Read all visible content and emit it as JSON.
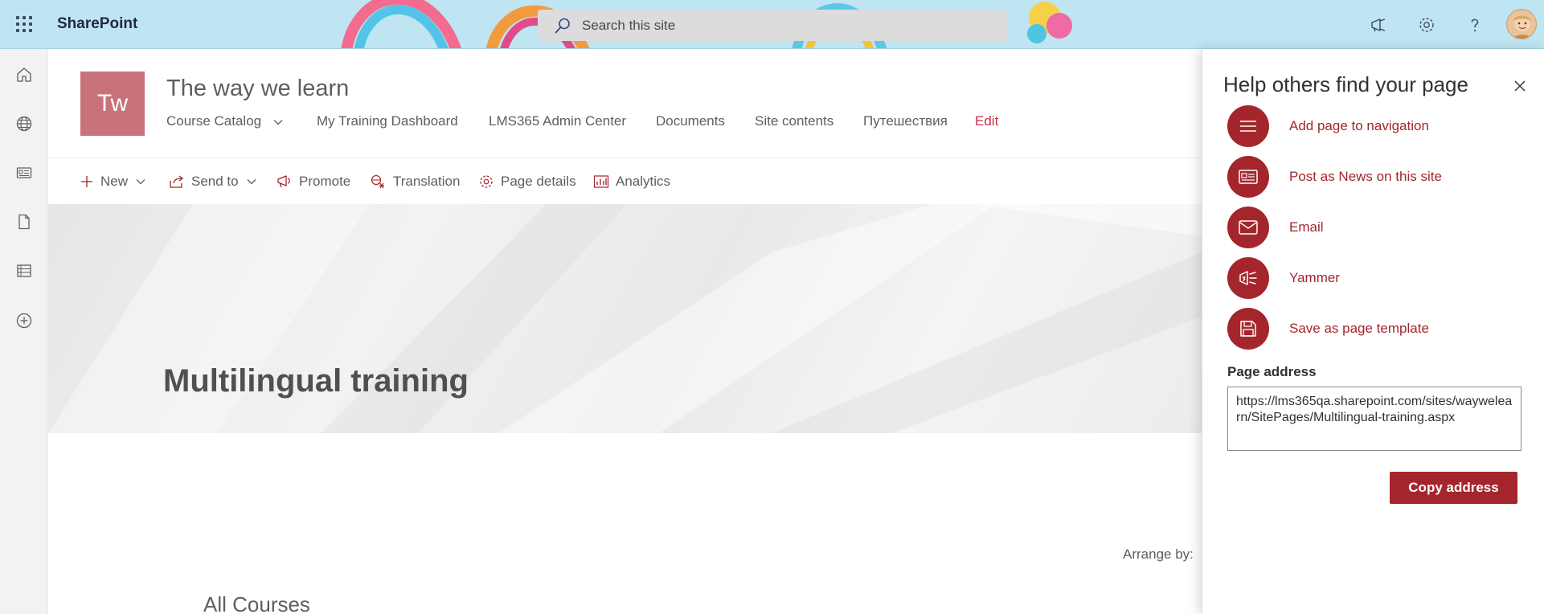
{
  "suitebar": {
    "brand": "SharePoint",
    "search_placeholder": "Search this site"
  },
  "site": {
    "logo_initials": "Tw",
    "title": "The way we learn",
    "nav": [
      {
        "label": "Course Catalog",
        "has_dropdown": true
      },
      {
        "label": "My Training Dashboard"
      },
      {
        "label": "LMS365 Admin Center"
      },
      {
        "label": "Documents"
      },
      {
        "label": "Site contents"
      },
      {
        "label": "Путешествия"
      },
      {
        "label": "Edit"
      }
    ]
  },
  "commandbar": {
    "new": "New",
    "send_to": "Send to",
    "promote": "Promote",
    "translation": "Translation",
    "page_details": "Page details",
    "analytics": "Analytics"
  },
  "page": {
    "banner_title": "Multilingual training",
    "arrange_by": "Arrange by:",
    "section_heading": "All Courses"
  },
  "panel": {
    "title": "Help others find your page",
    "actions": [
      {
        "label": "Add page to navigation",
        "icon": "menu-icon"
      },
      {
        "label": "Post as News on this site",
        "icon": "news-icon"
      },
      {
        "label": "Email",
        "icon": "mail-icon"
      },
      {
        "label": "Yammer",
        "icon": "yammer-icon"
      },
      {
        "label": "Save as page template",
        "icon": "save-icon"
      }
    ],
    "address_label": "Page address",
    "address_value": "https://lms365qa.sharepoint.com/sites/waywelearn/SitePages/Multilingual-training.aspx",
    "copy_button": "Copy address"
  },
  "colors": {
    "accent": "#a4262c",
    "site_logo": "#c9727a",
    "suitebar": "#bfe4f2"
  }
}
